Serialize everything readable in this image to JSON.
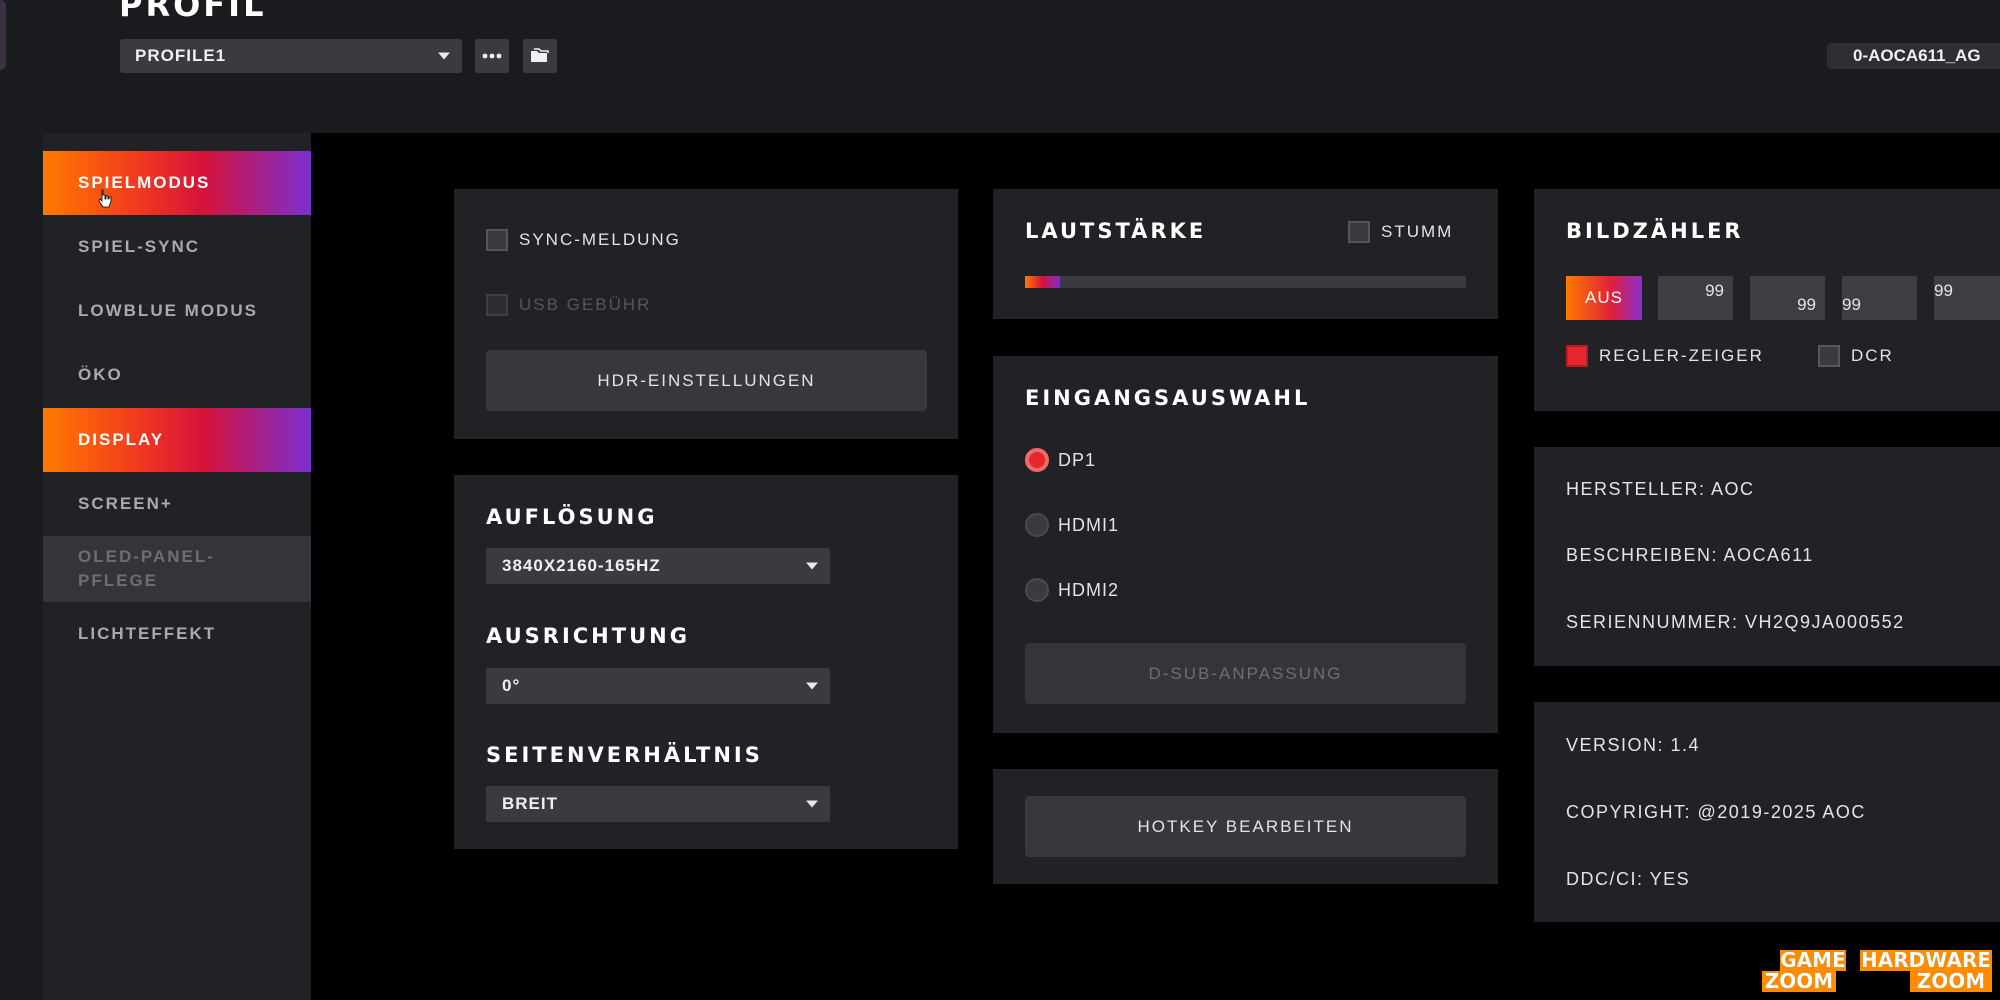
{
  "header": {
    "title": "PROFIL",
    "profile_value": "PROFILE1",
    "monitor_id": "0-AOCA611_AG"
  },
  "sidebar": {
    "items": [
      {
        "label": "SPIELMODUS"
      },
      {
        "label": "SPIEL-SYNC"
      },
      {
        "label": "LOWBLUE MODUS"
      },
      {
        "label": "ÖKO"
      },
      {
        "label": "DISPLAY"
      },
      {
        "label": "SCREEN+"
      },
      {
        "label": "OLED-PANEL-\nPFLEGE"
      },
      {
        "label": "LICHTEFFEKT"
      }
    ]
  },
  "sync_panel": {
    "sync_meldung": "SYNC-MELDUNG",
    "usb_gebuehr": "USB GEBÜHR",
    "hdr_button": "HDR-EINSTELLUNGEN"
  },
  "display_panel": {
    "resolution_title": "AUFLÖSUNG",
    "resolution_value": "3840X2160-165HZ",
    "orientation_title": "AUSRICHTUNG",
    "orientation_value": "0°",
    "aspect_title": "SEITENVERHÄLTNIS",
    "aspect_value": "BREIT"
  },
  "volume_panel": {
    "title": "LAUTSTÄRKE",
    "mute_label": "STUMM",
    "level_fraction": 0.08
  },
  "input_panel": {
    "title": "EINGANGSAUSWAHL",
    "options": [
      "DP1",
      "HDMI1",
      "HDMI2"
    ],
    "selected": "DP1",
    "dsub_button": "D-SUB-ANPASSUNG"
  },
  "hotkey_panel": {
    "button": "HOTKEY BEARBEITEN"
  },
  "frame_counter_panel": {
    "title": "BILDZÄHLER",
    "off_button": "AUS",
    "values": [
      "99",
      "99",
      "99",
      "99"
    ],
    "regler_zeiger": "REGLER-ZEIGER",
    "dcr": "DCR"
  },
  "info_panel": {
    "manufacturer": "HERSTELLER: AOC",
    "description": "BESCHREIBEN: AOCA611",
    "serial": "SERIENNUMMER: VH2Q9JA000552"
  },
  "version_panel": {
    "version": "VERSION: 1.4",
    "copyright": "COPYRIGHT: @2019-2025 AOC",
    "ddc": "DDC/CI: YES"
  },
  "watermark": {
    "left_top": "GAME",
    "left_bottom": "ZOOM",
    "right_top": "HARDWARE",
    "right_bottom": "ZOOM"
  },
  "colors": {
    "accent_orange": "#ff7a00",
    "accent_red": "#e7262e",
    "accent_purple": "#7b2fd0",
    "panel_bg": "#212226",
    "control_bg": "#3a3b40"
  }
}
